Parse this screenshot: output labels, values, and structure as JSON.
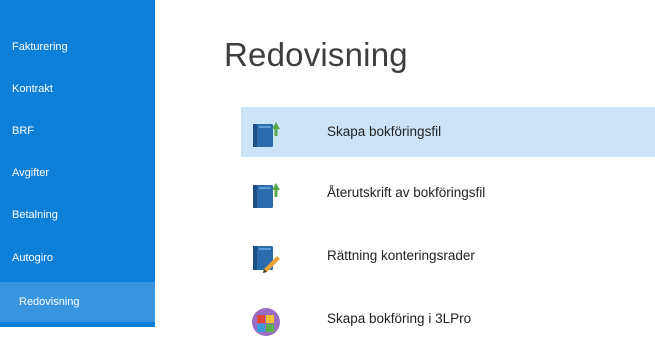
{
  "sidebar": {
    "items": [
      {
        "label": "Fakturering"
      },
      {
        "label": "Kontrakt"
      },
      {
        "label": "BRF"
      },
      {
        "label": "Avgifter"
      },
      {
        "label": "Betalning"
      },
      {
        "label": "Autogiro"
      },
      {
        "label": "Redovisning",
        "active": true
      }
    ]
  },
  "main": {
    "title": "Redovisning",
    "actions": [
      {
        "label": "Skapa bokföringsfil",
        "icon": "book-upload-icon",
        "selected": true
      },
      {
        "label": "Återutskrift av bokföringsfil",
        "icon": "book-upload-icon"
      },
      {
        "label": "Rättning konteringsrader",
        "icon": "book-edit-icon"
      },
      {
        "label": "Skapa bokföring i 3LPro",
        "icon": "3lpro-app-icon"
      }
    ]
  },
  "colors": {
    "sidebar_bg": "#0e7fd9",
    "sidebar_active_bg": "#3a95e0",
    "row_selected_bg": "#cce4f7"
  }
}
